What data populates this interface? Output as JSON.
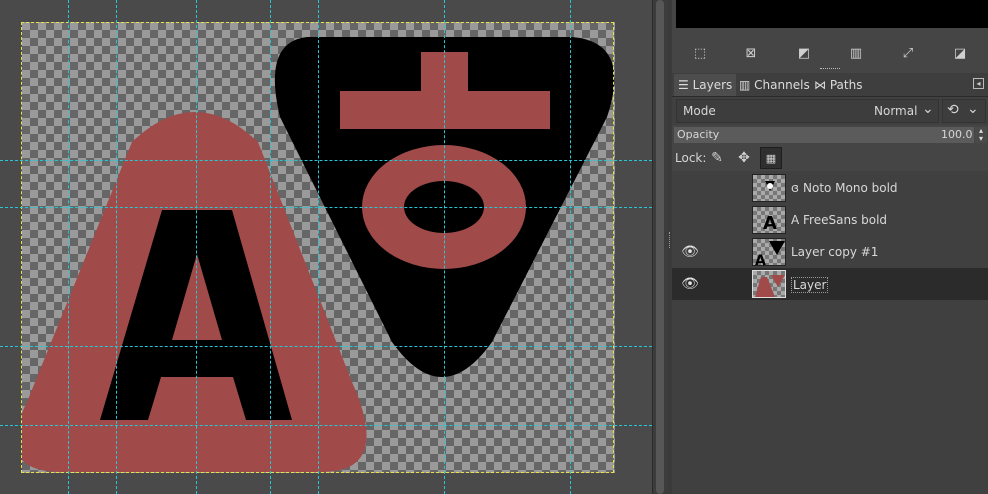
{
  "colors": {
    "brick": "#a04a4a",
    "black": "#000000",
    "guide": "#27c7d6",
    "image_border": "#e8e24a"
  },
  "canvas": {
    "glyph_a": "A"
  },
  "dock": {
    "tabs": [
      {
        "label": "Layers",
        "icon": "layers-icon"
      },
      {
        "label": "Channels",
        "icon": "channels-icon"
      },
      {
        "label": "Paths",
        "icon": "paths-icon"
      }
    ],
    "mode_label": "Mode",
    "mode_value": "Normal",
    "opacity_label": "Opacity",
    "opacity_value": "100.0",
    "lock_label": "Lock:",
    "layers": [
      {
        "name": "Noto Mono bold",
        "visible": false,
        "text_layer": true
      },
      {
        "name": "A FreeSans bold",
        "visible": false,
        "text_layer": true
      },
      {
        "name": "Layer copy #1",
        "visible": true,
        "text_layer": false
      },
      {
        "name": "Layer",
        "visible": true,
        "selected": true,
        "text_layer": false
      }
    ]
  }
}
